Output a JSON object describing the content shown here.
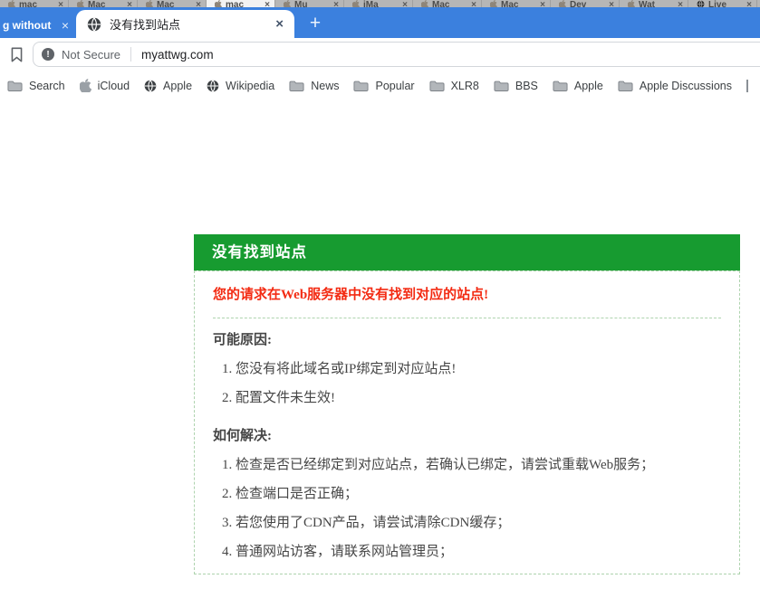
{
  "colors": {
    "frame_blue": "#3b80de",
    "header_green": "#179b30",
    "dashed_border": "#aed3ae",
    "message_red": "#f32b13",
    "ui_text": "#3c4043",
    "secondary_text": "#5f6368"
  },
  "icons": {
    "close": "×",
    "plus": "+",
    "not_secure_badge": "!"
  },
  "background_window": {
    "active_index": 3,
    "tabs": [
      {
        "label": "mac"
      },
      {
        "label": "Mac"
      },
      {
        "label": "Mac"
      },
      {
        "label": "mac"
      },
      {
        "label": "Mu"
      },
      {
        "label": "iMa"
      },
      {
        "label": "Mac"
      },
      {
        "label": "Mac"
      },
      {
        "label": "Dev"
      },
      {
        "label": "Wat"
      },
      {
        "label": "Live"
      }
    ]
  },
  "tab_bar": {
    "partial_tab_label": "g without",
    "active_tab_title": "没有找到站点"
  },
  "toolbar": {
    "security_label": "Not Secure",
    "url": "myattwg.com"
  },
  "bookmarks_bar": {
    "items": [
      {
        "icon": "folder-icon",
        "label": "Search"
      },
      {
        "icon": "apple-icon",
        "label": "iCloud"
      },
      {
        "icon": "globe-icon",
        "label": "Apple"
      },
      {
        "icon": "globe-icon",
        "label": "Wikipedia"
      },
      {
        "icon": "folder-icon",
        "label": "News"
      },
      {
        "icon": "folder-icon",
        "label": "Popular"
      },
      {
        "icon": "folder-icon",
        "label": "XLR8"
      },
      {
        "icon": "folder-icon",
        "label": "BBS"
      },
      {
        "icon": "folder-icon",
        "label": "Apple"
      },
      {
        "icon": "folder-icon",
        "label": "Apple Discussions"
      }
    ]
  },
  "error_page": {
    "title": "没有找到站点",
    "message": "您的请求在Web服务器中没有找到对应的站点!",
    "causes_heading": "可能原因:",
    "causes": [
      "您没有将此域名或IP绑定到对应站点!",
      "配置文件未生效!"
    ],
    "solutions_heading": "如何解决:",
    "solutions": [
      "检查是否已经绑定到对应站点，若确认已绑定，请尝试重载Web服务；",
      "检查端口是否正确；",
      "若您使用了CDN产品，请尝试清除CDN缓存；",
      "普通网站访客，请联系网站管理员；"
    ]
  }
}
